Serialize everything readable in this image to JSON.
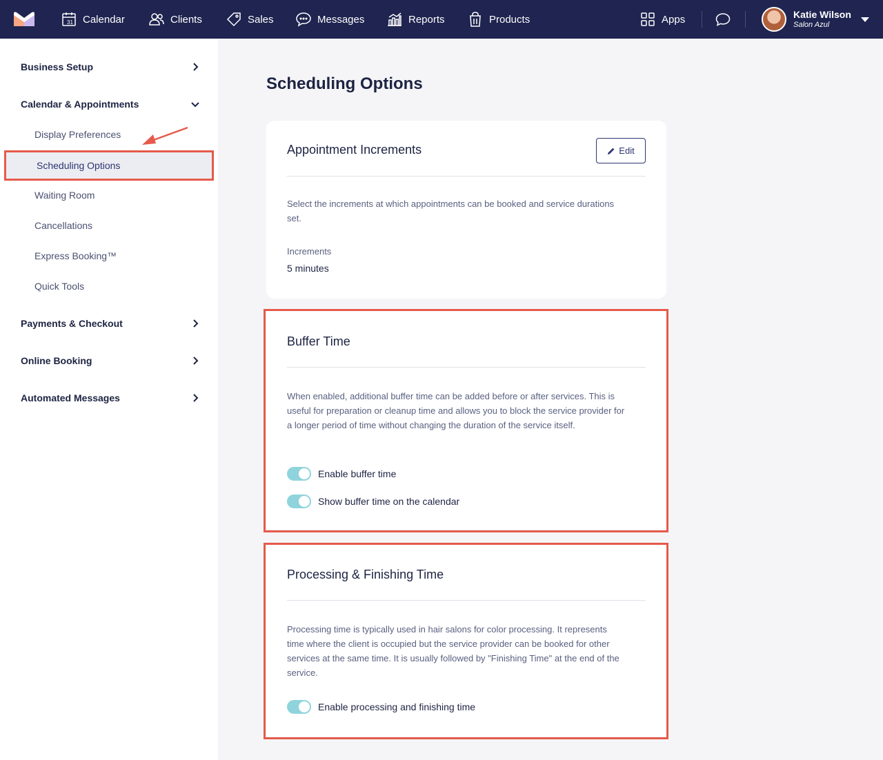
{
  "nav": {
    "items": [
      {
        "label": "Calendar",
        "icon": "calendar-icon"
      },
      {
        "label": "Clients",
        "icon": "clients-icon"
      },
      {
        "label": "Sales",
        "icon": "tag-icon"
      },
      {
        "label": "Messages",
        "icon": "messages-icon"
      },
      {
        "label": "Reports",
        "icon": "reports-icon"
      },
      {
        "label": "Products",
        "icon": "products-icon"
      }
    ],
    "apps_label": "Apps",
    "user_name": "Katie Wilson",
    "user_sub": "Salon Azul"
  },
  "sidebar": {
    "sections": [
      {
        "label": "Business Setup"
      },
      {
        "label": "Calendar & Appointments"
      },
      {
        "label": "Payments & Checkout"
      },
      {
        "label": "Online Booking"
      },
      {
        "label": "Automated Messages"
      }
    ],
    "sub_items": [
      {
        "label": "Display Preferences"
      },
      {
        "label": "Scheduling Options"
      },
      {
        "label": "Waiting Room"
      },
      {
        "label": "Cancellations"
      },
      {
        "label": "Express Booking™"
      },
      {
        "label": "Quick Tools"
      }
    ]
  },
  "main": {
    "title": "Scheduling Options",
    "increments": {
      "title": "Appointment Increments",
      "edit_label": "Edit",
      "description": "Select the increments at which appointments can be booked and service durations set.",
      "field_label": "Increments",
      "field_value": "5 minutes"
    },
    "buffer": {
      "title": "Buffer Time",
      "description": "When enabled, additional buffer time can be added before or after services. This is useful for preparation or cleanup time and allows you to block the service provider for a longer period of time without changing the duration of the service itself.",
      "toggles": [
        {
          "label": "Enable buffer time",
          "on": true
        },
        {
          "label": "Show buffer time on the calendar",
          "on": true
        }
      ]
    },
    "processing": {
      "title": "Processing & Finishing Time",
      "description": "Processing time is typically used in hair salons for color processing. It represents time where the client is occupied but the service provider can be booked for other services at the same time. It is usually followed by \"Finishing Time\" at the end of the service.",
      "toggles": [
        {
          "label": "Enable processing and finishing time",
          "on": true
        }
      ]
    }
  },
  "colors": {
    "nav_bg": "#1f2450",
    "highlight": "#e55a4a",
    "toggle_on": "#8fd4dc"
  }
}
